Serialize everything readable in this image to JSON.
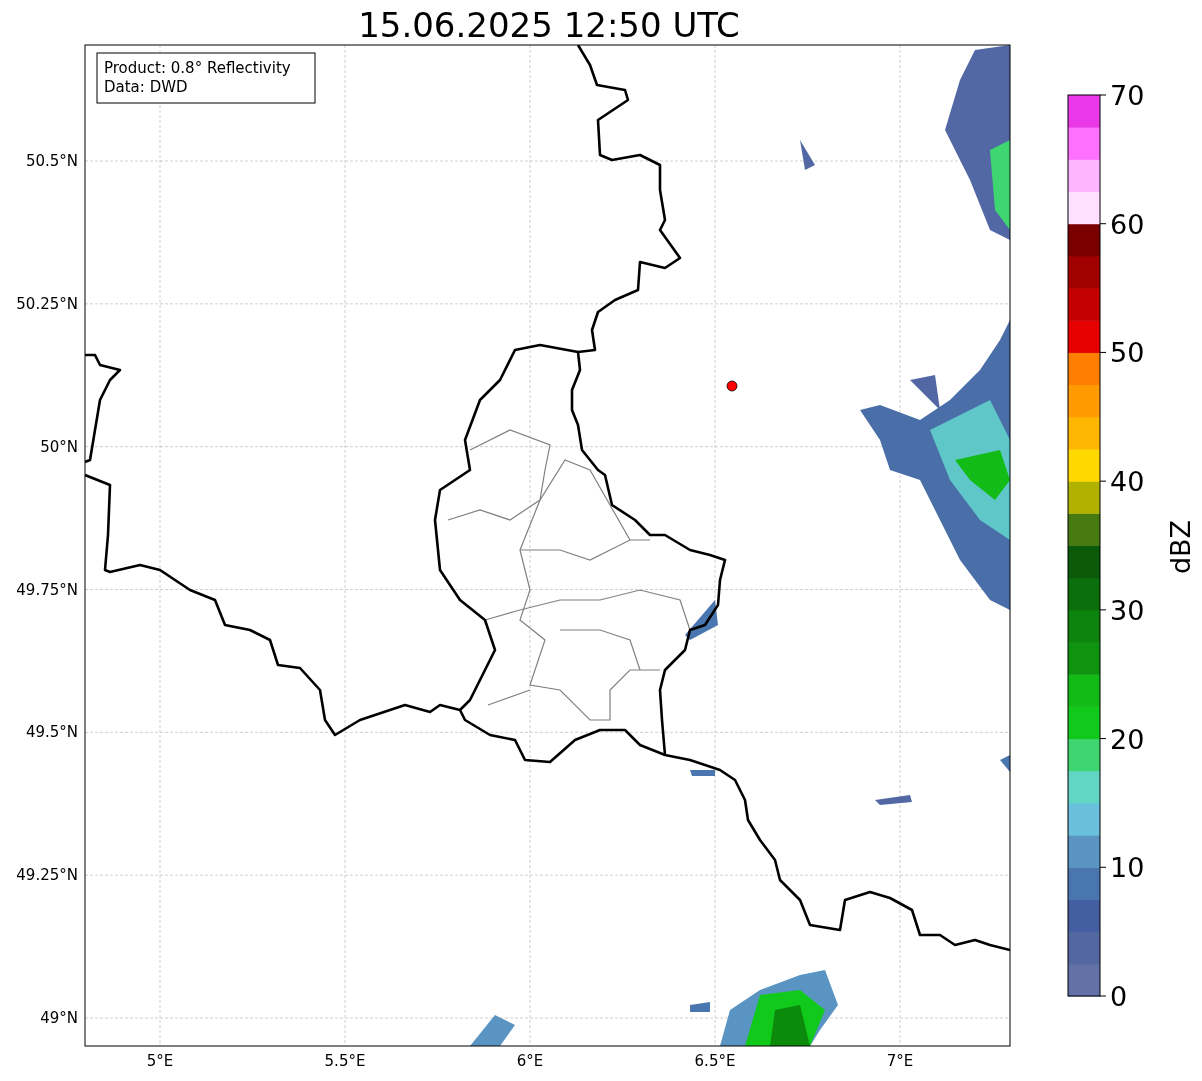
{
  "title": "15.06.2025 12:50 UTC",
  "info_box": [
    "Product: 0.8° Reflectivity",
    "Data: DWD"
  ],
  "y_ticks": [
    "50.5°N",
    "50.25°N",
    "50°N",
    "49.75°N",
    "49.5°N",
    "49.25°N",
    "49°N"
  ],
  "x_ticks": [
    "5°E",
    "5.5°E",
    "6°E",
    "6.5°E",
    "7°E"
  ],
  "colorbar": {
    "label": "dBZ",
    "ticks": [
      "70",
      "60",
      "50",
      "40",
      "30",
      "20",
      "10",
      "0"
    ],
    "segments": [
      {
        "color": "#6272a8"
      },
      {
        "color": "#5367a0"
      },
      {
        "color": "#445ea2"
      },
      {
        "color": "#4a76b0"
      },
      {
        "color": "#5a94c2"
      },
      {
        "color": "#68c0db"
      },
      {
        "color": "#62d6c4"
      },
      {
        "color": "#3fd672"
      },
      {
        "color": "#10c91a"
      },
      {
        "color": "#12bb16"
      },
      {
        "color": "#0f9410"
      },
      {
        "color": "#0d840d"
      },
      {
        "color": "#0b700b"
      },
      {
        "color": "#0a5a0a"
      },
      {
        "color": "#477a10"
      },
      {
        "color": "#b1b200"
      },
      {
        "color": "#ffd800"
      },
      {
        "color": "#ffb600"
      },
      {
        "color": "#ff9a00"
      },
      {
        "color": "#ff7e00"
      },
      {
        "color": "#e60000"
      },
      {
        "color": "#c40000"
      },
      {
        "color": "#a10000"
      },
      {
        "color": "#7a0000"
      },
      {
        "color": "#ffe0ff"
      },
      {
        "color": "#ffb4ff"
      },
      {
        "color": "#ff70ff"
      },
      {
        "color": "#e838e8"
      }
    ]
  }
}
